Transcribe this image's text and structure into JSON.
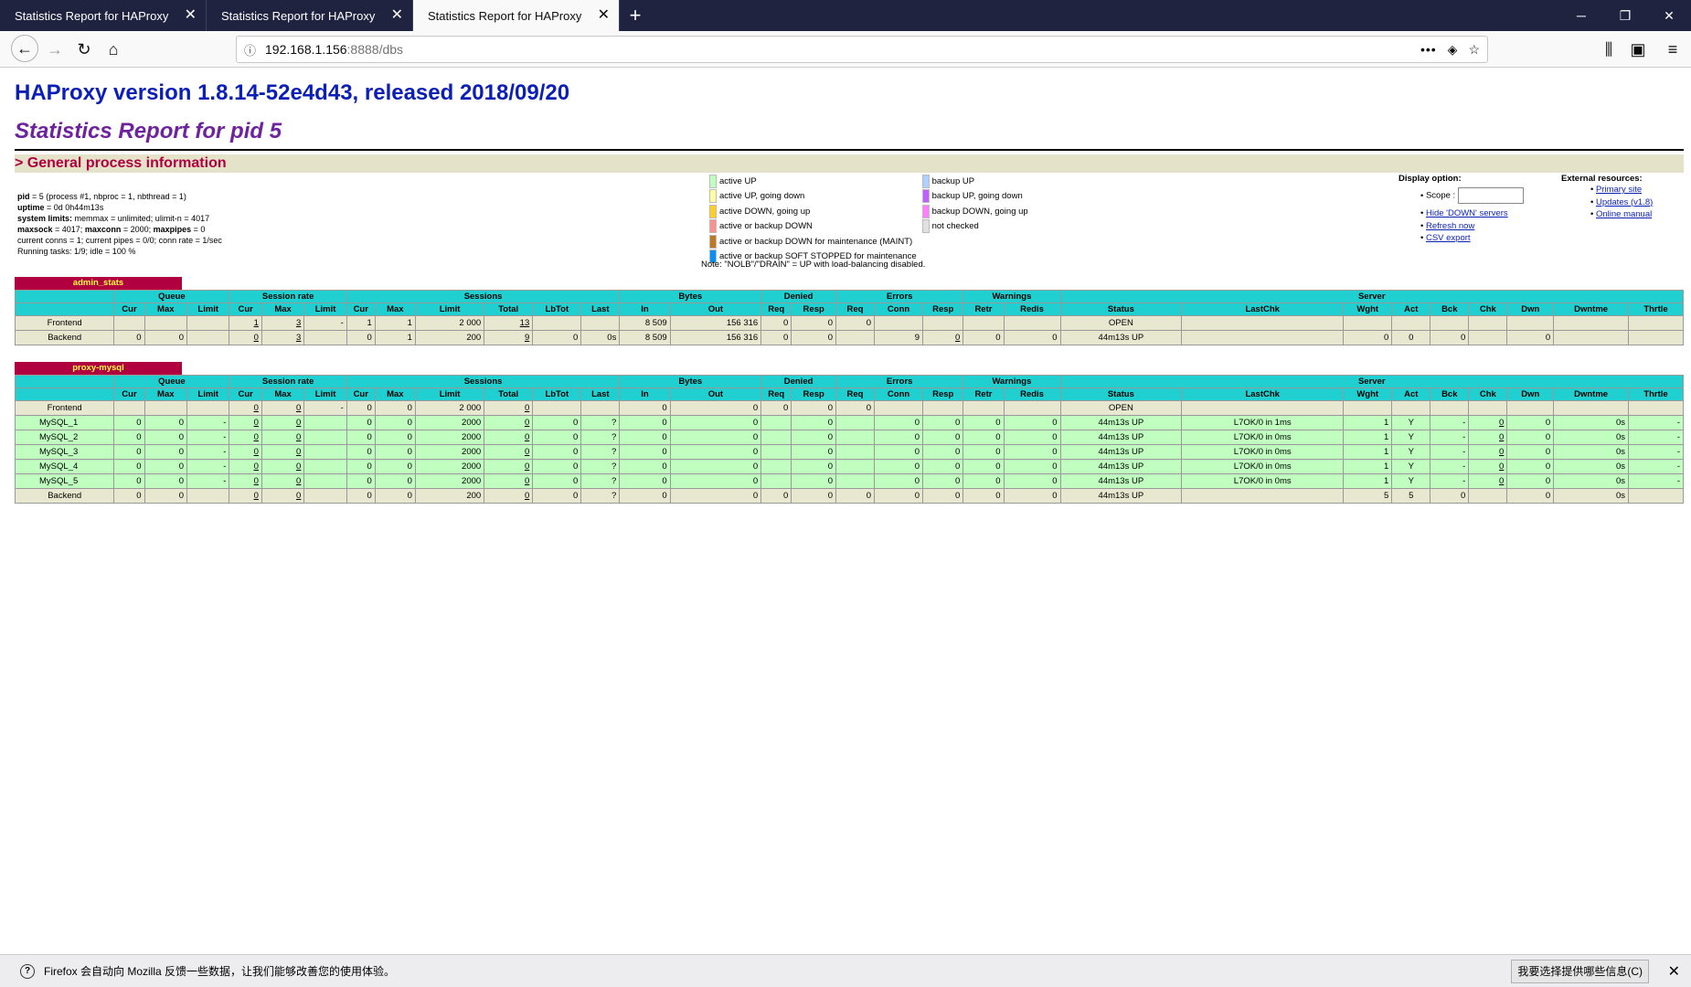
{
  "browser": {
    "tabs": [
      {
        "title": "Statistics Report for HAProxy"
      },
      {
        "title": "Statistics Report for HAProxy"
      },
      {
        "title": "Statistics Report for HAProxy"
      }
    ],
    "url_host": "192.168.1.156",
    "url_path": ":8888/dbs"
  },
  "page": {
    "title": "HAProxy version 1.8.14-52e4d43, released 2018/09/20",
    "subtitle": "Statistics Report for pid 5",
    "section": "> General process information",
    "process_info": {
      "pid_label": "pid",
      "pid_value": " = 5 (process #1, nbproc = 1, nbthread = 1)",
      "uptime_label": "uptime",
      "uptime_value": " = 0d 0h44m13s",
      "limits_label": "system limits:",
      "limits_value": " memmax = unlimited; ulimit-n = 4017",
      "maxsock_label": "maxsock",
      "maxsock_value": " = 4017; ",
      "maxconn_label": "maxconn",
      "maxconn_value": " = 2000; ",
      "maxpipes_label": "maxpipes",
      "maxpipes_value": " = 0",
      "conns": "current conns = 1; current pipes = 0/0; conn rate = 1/sec",
      "tasks": "Running tasks: 1/9; idle = 100 %"
    },
    "legend": [
      {
        "label": "active UP",
        "color": "#c0ffc0"
      },
      {
        "label": "active UP, going down",
        "color": "#ffffa0"
      },
      {
        "label": "active DOWN, going up",
        "color": "#ffd020"
      },
      {
        "label": "active or backup DOWN",
        "color": "#ff9090"
      },
      {
        "label": "active or backup DOWN for maintenance (MAINT)",
        "color": "#c07820"
      },
      {
        "label": "active or backup SOFT STOPPED for maintenance",
        "color": "#0090ff"
      }
    ],
    "legend2": [
      {
        "label": "backup UP",
        "color": "#b0d0ff"
      },
      {
        "label": "backup UP, going down",
        "color": "#c060ff"
      },
      {
        "label": "backup DOWN, going up",
        "color": "#ff80ff"
      },
      {
        "label": "not checked",
        "color": "#e0e0e0"
      }
    ],
    "note": "Note: \"NOLB\"/\"DRAIN\" = UP with load-balancing disabled.",
    "display_option": {
      "title": "Display option:",
      "scope_label": "Scope :",
      "links": [
        "Hide 'DOWN' servers",
        "Refresh now",
        "CSV export"
      ]
    },
    "external": {
      "title": "External resources:",
      "links": [
        "Primary site",
        "Updates (v1.8)",
        "Online manual"
      ]
    }
  },
  "tables": {
    "admin_stats": {
      "name": "admin_stats",
      "groups": [
        {
          "label": "",
          "span": 1
        },
        {
          "label": "Queue",
          "span": 3
        },
        {
          "label": "Session rate",
          "span": 3
        },
        {
          "label": "Sessions",
          "span": 6
        },
        {
          "label": "Bytes",
          "span": 2
        },
        {
          "label": "Denied",
          "span": 2
        },
        {
          "label": "Errors",
          "span": 3
        },
        {
          "label": "Warnings",
          "span": 2
        },
        {
          "label": "Server",
          "span": 9
        }
      ],
      "columns": [
        "",
        "Cur",
        "Max",
        "Limit",
        "Cur",
        "Max",
        "Limit",
        "Cur",
        "Max",
        "Limit",
        "Total",
        "LbTot",
        "Last",
        "In",
        "Out",
        "Req",
        "Resp",
        "Req",
        "Conn",
        "Resp",
        "Retr",
        "Redis",
        "Status",
        "LastChk",
        "Wght",
        "Act",
        "Bck",
        "Chk",
        "Dwn",
        "Dwntme",
        "Thrtle"
      ],
      "rows": [
        {
          "type": "fe",
          "cells": [
            "Frontend",
            "",
            "",
            "",
            "1",
            "3",
            "-",
            "1",
            "1",
            "2 000",
            "13",
            "",
            "",
            "8 509",
            "156 316",
            "0",
            "0",
            "0",
            "",
            "",
            "",
            "",
            "OPEN",
            "",
            "",
            "",
            "",
            "",
            "",
            "",
            ""
          ]
        },
        {
          "type": "be",
          "cells": [
            "Backend",
            "0",
            "0",
            "",
            "0",
            "3",
            "",
            "0",
            "1",
            "200",
            "9",
            "0",
            "0s",
            "8 509",
            "156 316",
            "0",
            "0",
            "",
            "9",
            "0",
            "0",
            "0",
            "44m13s UP",
            "",
            "0",
            "0",
            "0",
            "",
            "0",
            "",
            ""
          ]
        }
      ]
    },
    "proxy_mysql": {
      "name": "proxy-mysql",
      "groups": [
        {
          "label": "",
          "span": 1
        },
        {
          "label": "Queue",
          "span": 3
        },
        {
          "label": "Session rate",
          "span": 3
        },
        {
          "label": "Sessions",
          "span": 6
        },
        {
          "label": "Bytes",
          "span": 2
        },
        {
          "label": "Denied",
          "span": 2
        },
        {
          "label": "Errors",
          "span": 3
        },
        {
          "label": "Warnings",
          "span": 2
        },
        {
          "label": "Server",
          "span": 9
        }
      ],
      "columns": [
        "",
        "Cur",
        "Max",
        "Limit",
        "Cur",
        "Max",
        "Limit",
        "Cur",
        "Max",
        "Limit",
        "Total",
        "LbTot",
        "Last",
        "In",
        "Out",
        "Req",
        "Resp",
        "Req",
        "Conn",
        "Resp",
        "Retr",
        "Redis",
        "Status",
        "LastChk",
        "Wght",
        "Act",
        "Bck",
        "Chk",
        "Dwn",
        "Dwntme",
        "Thrtle"
      ],
      "rows": [
        {
          "type": "fe",
          "cells": [
            "Frontend",
            "",
            "",
            "",
            "0",
            "0",
            "-",
            "0",
            "0",
            "2 000",
            "0",
            "",
            "",
            "0",
            "0",
            "0",
            "0",
            "0",
            "",
            "",
            "",
            "",
            "OPEN",
            "",
            "",
            "",
            "",
            "",
            "",
            "",
            ""
          ]
        },
        {
          "type": "up",
          "cells": [
            "MySQL_1",
            "0",
            "0",
            "-",
            "0",
            "0",
            "",
            "0",
            "0",
            "2000",
            "0",
            "0",
            "?",
            "0",
            "0",
            "",
            "0",
            "",
            "0",
            "0",
            "0",
            "0",
            "44m13s UP",
            "L7OK/0 in 1ms",
            "1",
            "Y",
            "-",
            "0",
            "0",
            "0s",
            "-"
          ]
        },
        {
          "type": "up",
          "cells": [
            "MySQL_2",
            "0",
            "0",
            "-",
            "0",
            "0",
            "",
            "0",
            "0",
            "2000",
            "0",
            "0",
            "?",
            "0",
            "0",
            "",
            "0",
            "",
            "0",
            "0",
            "0",
            "0",
            "44m13s UP",
            "L7OK/0 in 0ms",
            "1",
            "Y",
            "-",
            "0",
            "0",
            "0s",
            "-"
          ]
        },
        {
          "type": "up",
          "cells": [
            "MySQL_3",
            "0",
            "0",
            "-",
            "0",
            "0",
            "",
            "0",
            "0",
            "2000",
            "0",
            "0",
            "?",
            "0",
            "0",
            "",
            "0",
            "",
            "0",
            "0",
            "0",
            "0",
            "44m13s UP",
            "L7OK/0 in 0ms",
            "1",
            "Y",
            "-",
            "0",
            "0",
            "0s",
            "-"
          ]
        },
        {
          "type": "up",
          "cells": [
            "MySQL_4",
            "0",
            "0",
            "-",
            "0",
            "0",
            "",
            "0",
            "0",
            "2000",
            "0",
            "0",
            "?",
            "0",
            "0",
            "",
            "0",
            "",
            "0",
            "0",
            "0",
            "0",
            "44m13s UP",
            "L7OK/0 in 0ms",
            "1",
            "Y",
            "-",
            "0",
            "0",
            "0s",
            "-"
          ]
        },
        {
          "type": "up",
          "cells": [
            "MySQL_5",
            "0",
            "0",
            "-",
            "0",
            "0",
            "",
            "0",
            "0",
            "2000",
            "0",
            "0",
            "?",
            "0",
            "0",
            "",
            "0",
            "",
            "0",
            "0",
            "0",
            "0",
            "44m13s UP",
            "L7OK/0 in 0ms",
            "1",
            "Y",
            "-",
            "0",
            "0",
            "0s",
            "-"
          ]
        },
        {
          "type": "be",
          "cells": [
            "Backend",
            "0",
            "0",
            "",
            "0",
            "0",
            "",
            "0",
            "0",
            "200",
            "0",
            "0",
            "?",
            "0",
            "0",
            "0",
            "0",
            "0",
            "0",
            "0",
            "0",
            "0",
            "44m13s UP",
            "",
            "5",
            "5",
            "0",
            "",
            "0",
            "0s",
            ""
          ]
        }
      ]
    }
  },
  "notification": {
    "text": "Firefox 会自动向 Mozilla 反馈一些数据，让我们能够改善您的使用体验。",
    "button": "我要选择提供哪些信息(C)"
  }
}
